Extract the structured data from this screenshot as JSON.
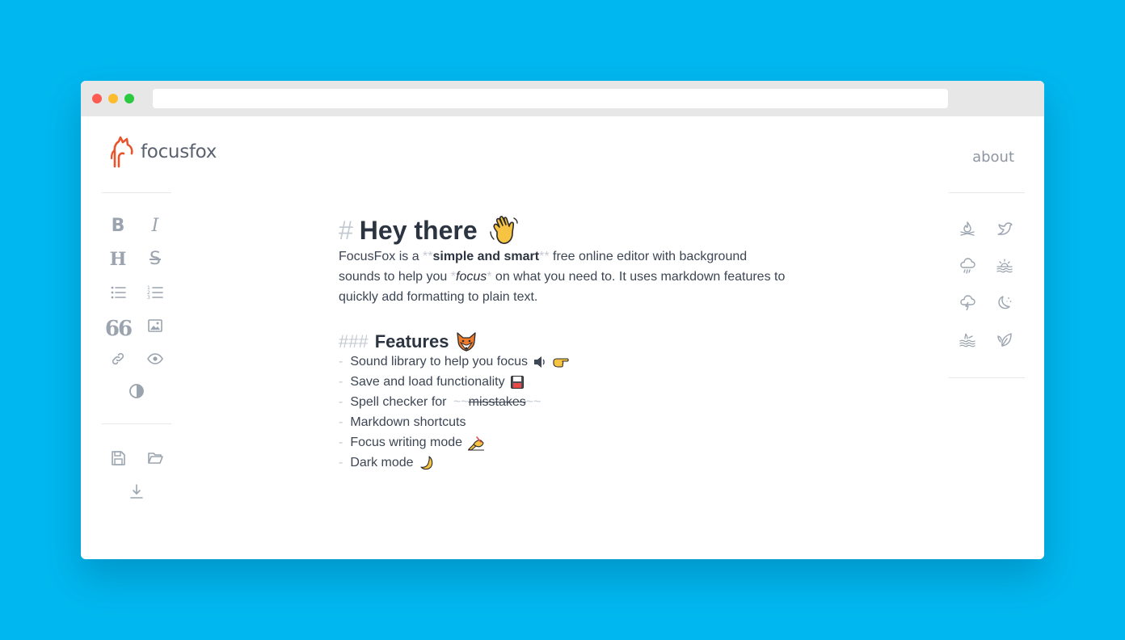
{
  "browser": {
    "url": ""
  },
  "header": {
    "logo_text": "focusfox",
    "about_label": "about"
  },
  "toolbar_left": {
    "bold_label": "B",
    "italic_label": "I",
    "heading_label": "H",
    "strike_label": "S",
    "quote_label": "66",
    "items": [
      "bold",
      "italic",
      "heading",
      "strikethrough",
      "bullet-list",
      "numbered-list",
      "quote",
      "image",
      "link",
      "preview",
      "contrast",
      "save",
      "open-folder",
      "download"
    ]
  },
  "sounds_right": {
    "items": [
      "campfire",
      "birds",
      "rain",
      "sunrise-waves",
      "thunderstorm",
      "night",
      "water",
      "leaves"
    ]
  },
  "editor": {
    "h1_marker": "#",
    "h1_text": "Hey there",
    "intro": {
      "t1": "FocusFox is a ",
      "m1": "**",
      "b1": "simple and smart",
      "m2": "**",
      "t2": " free online editor with background sounds to help you ",
      "m3": "*",
      "i1": "focus",
      "m4": "*",
      "t3": " on what you need to. It uses markdown features to quickly add formatting to plain text."
    },
    "h3_marker": "###",
    "h3_text": "Features",
    "list_marker": "-",
    "features": [
      {
        "text": "Sound library to help you focus"
      },
      {
        "text": "Save and load functionality"
      },
      {
        "text": "Spell checker for ",
        "tilde_open": "~~",
        "strike": "misstakes",
        "tilde_close": "~~"
      },
      {
        "text": "Markdown shortcuts"
      },
      {
        "text": "Focus writing mode"
      },
      {
        "text": "Dark mode"
      }
    ]
  },
  "colors": {
    "background": "#00b8ef",
    "window": "#ffffff",
    "titlebar": "#e7e7e7",
    "icon": "#9aa3ae",
    "text": "#3c4654",
    "markdown_marker": "#c4cad1",
    "logo_accent": "#e8542c"
  }
}
